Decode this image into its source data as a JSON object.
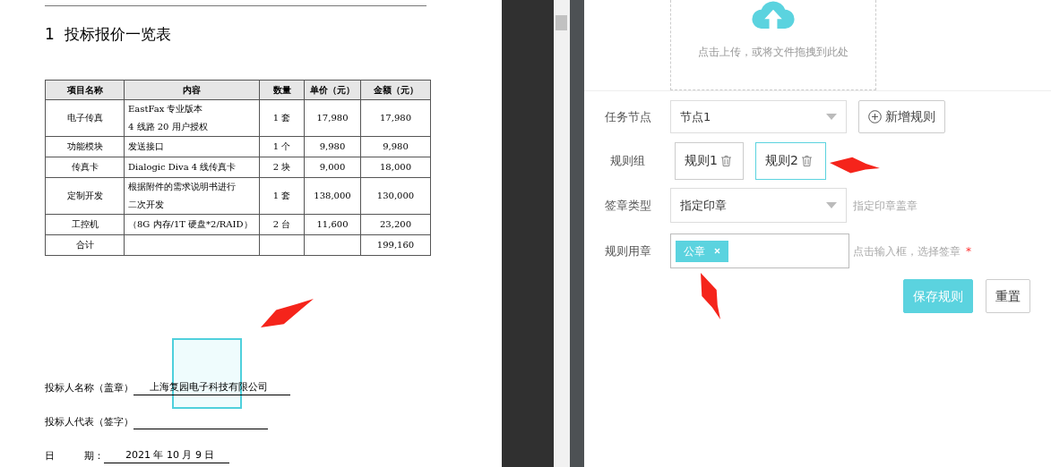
{
  "document": {
    "heading": "1  投标报价一览表",
    "table": {
      "columns": [
        "项目名称",
        "内容",
        "数量",
        "单价（元）",
        "金额（元）"
      ],
      "rows": [
        {
          "cells": [
            "电子传真",
            [
              "EastFax 专业版本",
              "4 线路 20 用户授权"
            ],
            "1 套",
            "17,980",
            "17,980"
          ]
        },
        {
          "cells": [
            "功能模块",
            "发送接口",
            "1 个",
            "9,980",
            "9,980"
          ]
        },
        {
          "cells": [
            "传真卡",
            "Dialogic Diva 4 线传真卡",
            "2 块",
            "9,000",
            "18,000"
          ]
        },
        {
          "cells": [
            "定制开发",
            [
              "根据附件的需求说明书进行",
              "二次开发"
            ],
            "1 套",
            "138,000",
            "130,000"
          ]
        },
        {
          "cells": [
            "工控机",
            "（8G 内存/1T 硬盘*2/RAID）",
            "2 台",
            "11,600",
            "23,200"
          ]
        },
        {
          "cells": [
            "合计",
            "",
            "",
            "",
            "199,160"
          ]
        }
      ]
    },
    "signature_lines": [
      {
        "label": "投标人名称（盖章）",
        "value": "上海复园电子科技有限公司"
      },
      {
        "label": "投标人代表（签字）"
      },
      {
        "label": "日　　　期：",
        "value": "2021 年 10 月 9 日"
      }
    ]
  },
  "form": {
    "upload": {
      "hint": "点击上传，或将文件拖拽到此处"
    },
    "task_node": {
      "label": "任务节点",
      "value": "节点1",
      "add_button": "新增规则"
    },
    "rule_group": {
      "label": "规则组",
      "rules": [
        {
          "name": "规则1",
          "selected": false
        },
        {
          "name": "规则2",
          "selected": true
        }
      ]
    },
    "sign_type": {
      "label": "签章类型",
      "value": "指定印章",
      "hint": "指定印章盖章"
    },
    "rule_seal": {
      "label": "规则用章",
      "tags": [
        {
          "name": "公章"
        }
      ],
      "hint": "点击输入框，选择签章",
      "required_mark": "*"
    },
    "buttons": [
      {
        "label": "保存规则",
        "kind": "primary"
      },
      {
        "label": "重置",
        "kind": "default"
      }
    ]
  }
}
